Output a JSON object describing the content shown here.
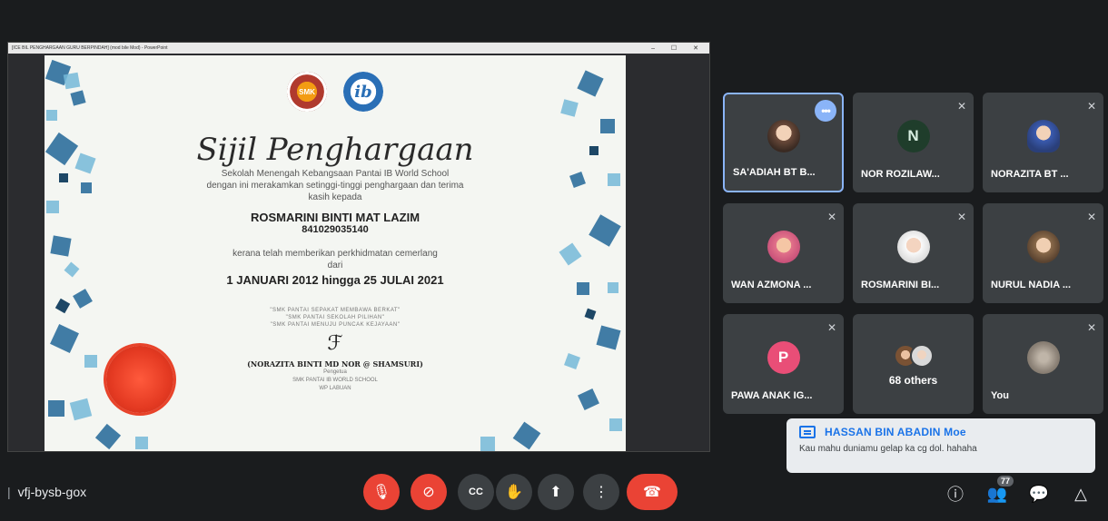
{
  "presentation": {
    "window_title": "[ICE BIL PENGHARGAAN GURU BERPINDAH] (mod bile Mod) - PowerPoint",
    "window_controls": "– ☐ ✕",
    "certificate": {
      "logo_school": "SMK",
      "logo_ib": "ib",
      "title": "Sijil Penghargaan",
      "school_line": "Sekolah Menengah Kebangsaan Pantai IB World School",
      "line2": "dengan ini merakamkan setinggi-tinggi penghargaan dan terima",
      "line3": "kasih kepada",
      "recipient_name": "ROSMARINI BINTI MAT LAZIM",
      "recipient_id": "841029035140",
      "service_line": "kerana telah memberikan perkhidmatan cemerlang",
      "from_label": "dari",
      "dates": "1 JANUARI 2012 hingga 25 JULAI 2021",
      "motto_1": "\"SMK PANTAI SEPAKAT MEMBAWA BERKAT\"",
      "motto_2": "\"SMK PANTAI SEKOLAH PILIHAN\"",
      "motto_3": "\"SMK PANTAI MENUJU PUNCAK KEJAYAAN\"",
      "signature": "ℱ",
      "signer": "(NORAZITA BINTI MD NOR @ SHAMSURI)",
      "signer_role": "Pengetua",
      "signer_school": "SMK PANTAI IB WORLD SCHOOL",
      "signer_place": "WP LABUAN"
    }
  },
  "participants": [
    {
      "name": "SA'ADIAH BT B...",
      "avatar": "photo",
      "active": true,
      "more_label": "•••"
    },
    {
      "name": "NOR ROZILAW...",
      "avatar": "letter",
      "initial": "N",
      "muted": true
    },
    {
      "name": "NORAZITA BT ...",
      "avatar": "hijab",
      "muted": true
    },
    {
      "name": "WAN AZMONA ...",
      "avatar": "pink",
      "muted": true
    },
    {
      "name": "ROSMARINI BI...",
      "avatar": "white",
      "muted": true
    },
    {
      "name": "NURUL NADIA ...",
      "avatar": "brown",
      "muted": true
    },
    {
      "name": "PAWA ANAK IG...",
      "avatar": "letter",
      "initial": "P",
      "muted": true
    },
    {
      "name": "68 others",
      "avatar": "stack"
    },
    {
      "name": "You",
      "avatar": "wall",
      "muted": true
    }
  ],
  "mute_glyph": "✕",
  "chat_toast": {
    "sender": "HASSAN BIN ABADIN Moe",
    "message": "Kau mahu duniamu gelap ka cg dol. hahaha"
  },
  "bottom_bar": {
    "separator": "|",
    "meeting_code": "vfj-bysb-gox",
    "controls": {
      "mic_off": "🎙",
      "cam_off": "⊘",
      "captions": "CC",
      "raise_hand": "✋",
      "present": "⬆",
      "more": "⋮",
      "end_call": "☎"
    },
    "right": {
      "info": "ⓘ",
      "people": "👥",
      "people_count": "77",
      "chat": "💬",
      "activities": "△"
    }
  },
  "colors": {
    "background": "#1a1c1e",
    "tile": "#3c4043",
    "accent_blue": "#8ab4f8",
    "danger_red": "#ea4335"
  }
}
